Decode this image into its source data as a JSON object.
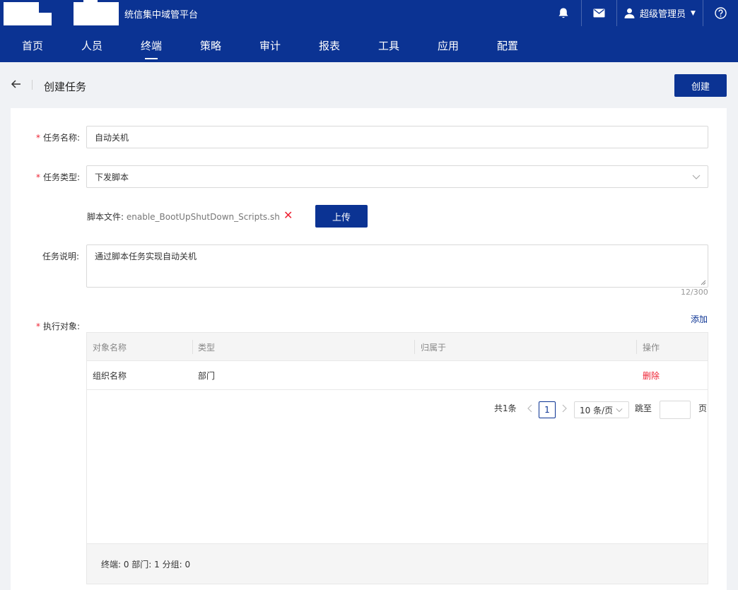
{
  "header": {
    "platform_title": "统信集中域管平台",
    "user_name": "超级管理员",
    "user_caret": "▼"
  },
  "nav": {
    "items": [
      {
        "label": "首页"
      },
      {
        "label": "人员"
      },
      {
        "label": "终端"
      },
      {
        "label": "策略"
      },
      {
        "label": "审计"
      },
      {
        "label": "报表"
      },
      {
        "label": "工具"
      },
      {
        "label": "应用"
      },
      {
        "label": "配置"
      }
    ],
    "active": "终端"
  },
  "page": {
    "title": "创建任务",
    "create_button": "创建"
  },
  "form": {
    "required_mark": "*",
    "task_name": {
      "label": "任务名称:",
      "value": "自动关机"
    },
    "task_type": {
      "label": "任务类型:",
      "value": "下发脚本"
    },
    "script_file": {
      "label": "脚本文件:",
      "value": "enable_BootUpShutDown_Scripts.sh",
      "delete_glyph": "✕",
      "upload_button": "上传"
    },
    "task_desc": {
      "label": "任务说明:",
      "value": "通过脚本任务实现自动关机",
      "counter": "12/300"
    },
    "targets": {
      "label": "执行对象:",
      "add_link": "添加",
      "columns": [
        "对象名称",
        "类型",
        "归属于",
        "操作"
      ],
      "rows": [
        {
          "name": "组织名称",
          "type": "部门",
          "owner": "",
          "action": "删除"
        }
      ],
      "pagination": {
        "total": "共1条",
        "current_page": "1",
        "page_size": "10 条/页",
        "jump_label": "跳至",
        "page_suffix": "页"
      },
      "summary": "终端: 0 部门: 1 分组: 0"
    }
  }
}
